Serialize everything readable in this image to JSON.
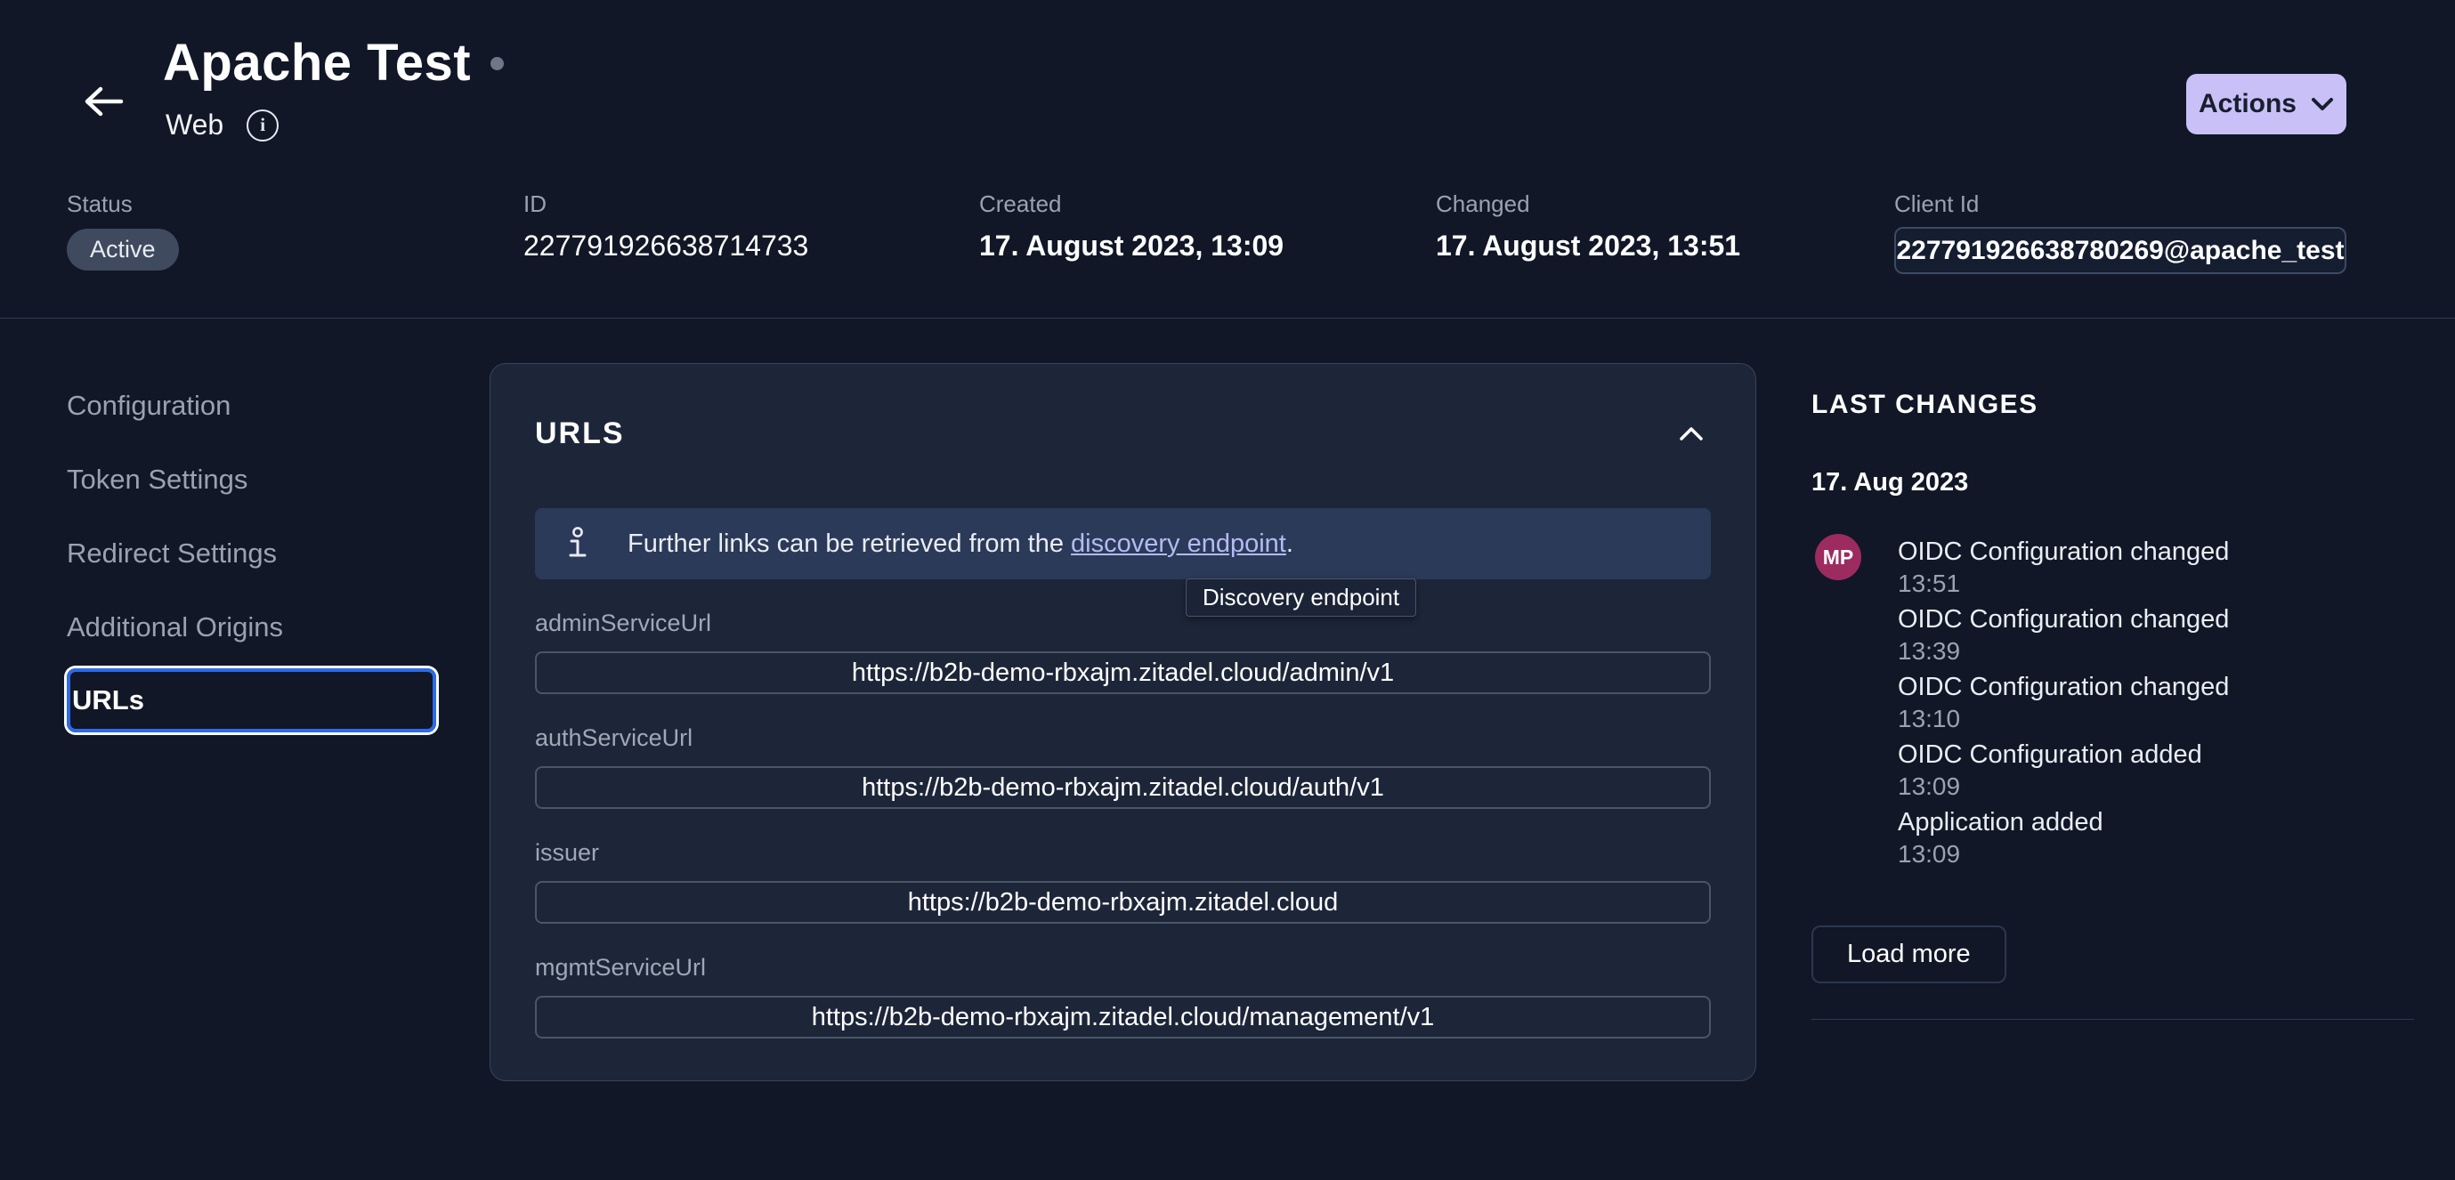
{
  "header": {
    "title": "Apache Test",
    "subtitle": "Web",
    "actions_label": "Actions"
  },
  "meta": {
    "status_label": "Status",
    "status_value": "Active",
    "id_label": "ID",
    "id_value": "227791926638714733",
    "created_label": "Created",
    "created_value": "17. August 2023, 13:09",
    "changed_label": "Changed",
    "changed_value": "17. August 2023, 13:51",
    "client_id_label": "Client Id",
    "client_id_value": "227791926638780269@apache_test"
  },
  "sidebar": {
    "items": [
      {
        "label": "Configuration"
      },
      {
        "label": "Token Settings"
      },
      {
        "label": "Redirect Settings"
      },
      {
        "label": "Additional Origins"
      },
      {
        "label": "URLs"
      }
    ]
  },
  "urls_card": {
    "title": "URLS",
    "banner": {
      "text_before_link": "Further links can be retrieved from the ",
      "link_text": "discovery endpoint",
      "text_after_link": "."
    },
    "tooltip": "Discovery endpoint",
    "fields": [
      {
        "label": "adminServiceUrl",
        "value": "https://b2b-demo-rbxajm.zitadel.cloud/admin/v1"
      },
      {
        "label": "authServiceUrl",
        "value": "https://b2b-demo-rbxajm.zitadel.cloud/auth/v1"
      },
      {
        "label": "issuer",
        "value": "https://b2b-demo-rbxajm.zitadel.cloud"
      },
      {
        "label": "mgmtServiceUrl",
        "value": "https://b2b-demo-rbxajm.zitadel.cloud/management/v1"
      }
    ]
  },
  "changes": {
    "title": "LAST CHANGES",
    "date": "17. Aug 2023",
    "avatar_initials": "MP",
    "events": [
      {
        "title": "OIDC Configuration changed",
        "time": "13:51"
      },
      {
        "title": "OIDC Configuration changed",
        "time": "13:39"
      },
      {
        "title": "OIDC Configuration changed",
        "time": "13:10"
      },
      {
        "title": "OIDC Configuration added",
        "time": "13:09"
      },
      {
        "title": "Application added",
        "time": "13:09"
      }
    ],
    "load_more_label": "Load more"
  },
  "icons": {
    "back": "arrow-left-icon",
    "app_info": "info-circle-icon",
    "actions": "chevron-down-icon",
    "collapse": "chevron-up-icon",
    "banner": "info-icon"
  },
  "colors": {
    "page_bg": "#111726",
    "card_bg": "#1d2639",
    "card_border": "#39435d",
    "banner_bg": "#2b3a58",
    "link": "#b6baf1",
    "tooltip_bg": "#1b2336",
    "tooltip_border": "#4a5470",
    "input_border": "#4a5568",
    "active_blue": "#2e6be5",
    "actions_bg": "#c8c0f6",
    "actions_text": "#171e2e",
    "pill_bg": "#3f4a5e",
    "avatar_bg": "#9c2b60",
    "divider": "#323c55",
    "text_primary": "#ffffff",
    "text_secondary": "#9aa2b2",
    "chip_bg": "#151d30",
    "chip_border": "#3d4a66"
  }
}
